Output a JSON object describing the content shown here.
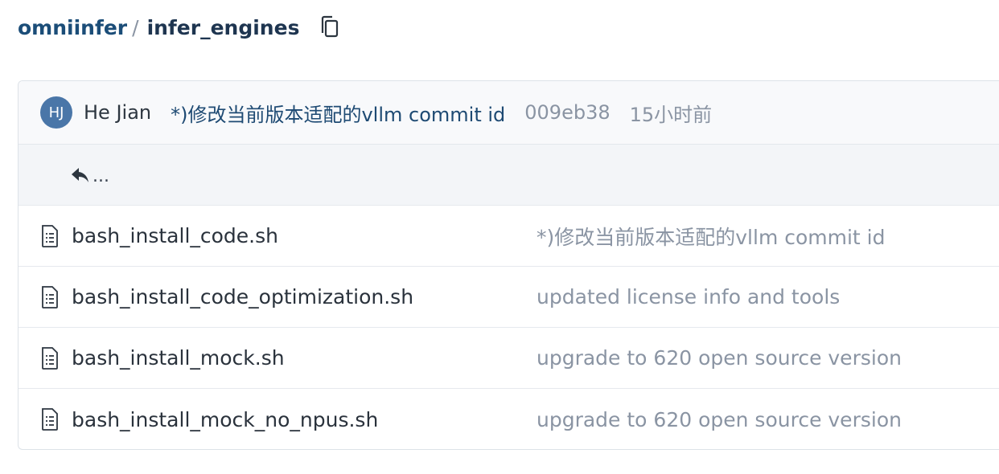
{
  "breadcrumb": {
    "owner": "omniinfer",
    "separator": "/",
    "repo": "infer_engines"
  },
  "icons": {
    "copy": "copy-icon",
    "back": "reply-arrow-icon",
    "file": "file-text-icon"
  },
  "latest_commit": {
    "avatar_initials": "HJ",
    "avatar_color": "#4a76a8",
    "author": "He Jian",
    "message": "*)修改当前版本适配的vllm commit id",
    "sha": "009eb38",
    "time": "15小时前"
  },
  "back_row": {
    "label": "..."
  },
  "files": [
    {
      "name": "bash_install_code.sh",
      "commit": "*)修改当前版本适配的vllm commit id"
    },
    {
      "name": "bash_install_code_optimization.sh",
      "commit": "updated license info and tools"
    },
    {
      "name": "bash_install_mock.sh",
      "commit": "upgrade to 620 open source version"
    },
    {
      "name": "bash_install_mock_no_npus.sh",
      "commit": "upgrade to 620 open source version"
    }
  ]
}
